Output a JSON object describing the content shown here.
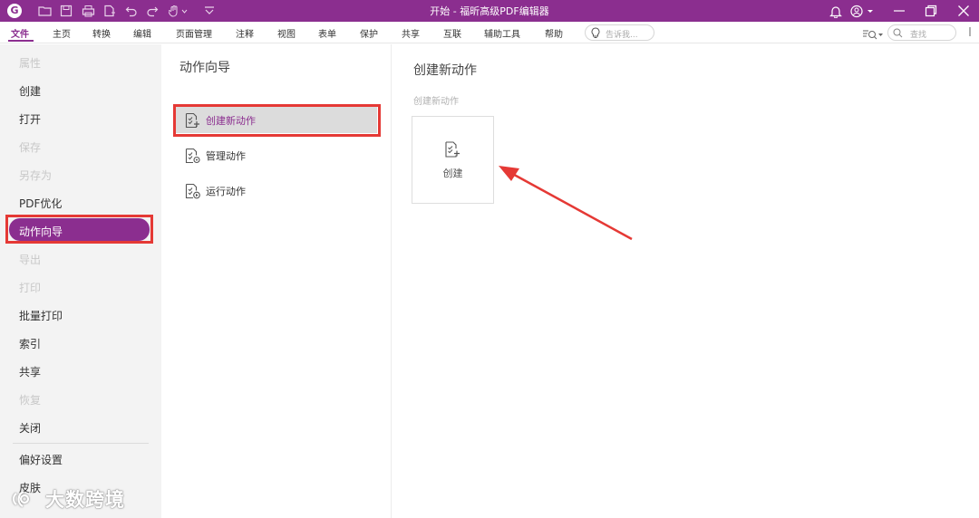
{
  "window": {
    "title": "开始 - 福昕高级PDF编辑器",
    "logo_letter": "G"
  },
  "menu": {
    "items": [
      "文件",
      "主页",
      "转换",
      "编辑",
      "页面管理",
      "注释",
      "视图",
      "表单",
      "保护",
      "共享",
      "互联",
      "辅助工具",
      "帮助"
    ],
    "active_index": 0,
    "tell_me_placeholder": "告诉我...",
    "search_placeholder": "查找"
  },
  "sidebar": {
    "items": [
      {
        "label": "属性",
        "enabled": false
      },
      {
        "label": "创建",
        "enabled": true
      },
      {
        "label": "打开",
        "enabled": true
      },
      {
        "label": "保存",
        "enabled": false
      },
      {
        "label": "另存为",
        "enabled": false
      },
      {
        "label": "PDF优化",
        "enabled": true
      },
      {
        "label": "动作向导",
        "enabled": true,
        "selected": true
      },
      {
        "label": "导出",
        "enabled": false
      },
      {
        "label": "打印",
        "enabled": false
      },
      {
        "label": "批量打印",
        "enabled": true
      },
      {
        "label": "索引",
        "enabled": true
      },
      {
        "label": "共享",
        "enabled": true
      },
      {
        "label": "恢复",
        "enabled": false
      },
      {
        "label": "关闭",
        "enabled": true
      },
      {
        "label": "偏好设置",
        "enabled": true
      },
      {
        "label": "皮肤",
        "enabled": true
      }
    ]
  },
  "middle": {
    "title": "动作向导",
    "items": [
      {
        "label": "创建新动作",
        "selected": true
      },
      {
        "label": "管理动作",
        "selected": false
      },
      {
        "label": "运行动作",
        "selected": false
      }
    ]
  },
  "right": {
    "title": "创建新动作",
    "subtitle": "创建新动作",
    "card_label": "创建"
  },
  "watermark": {
    "text": "大数跨境"
  },
  "colors": {
    "accent": "#8b2e8f",
    "highlight_red": "#e53935"
  }
}
